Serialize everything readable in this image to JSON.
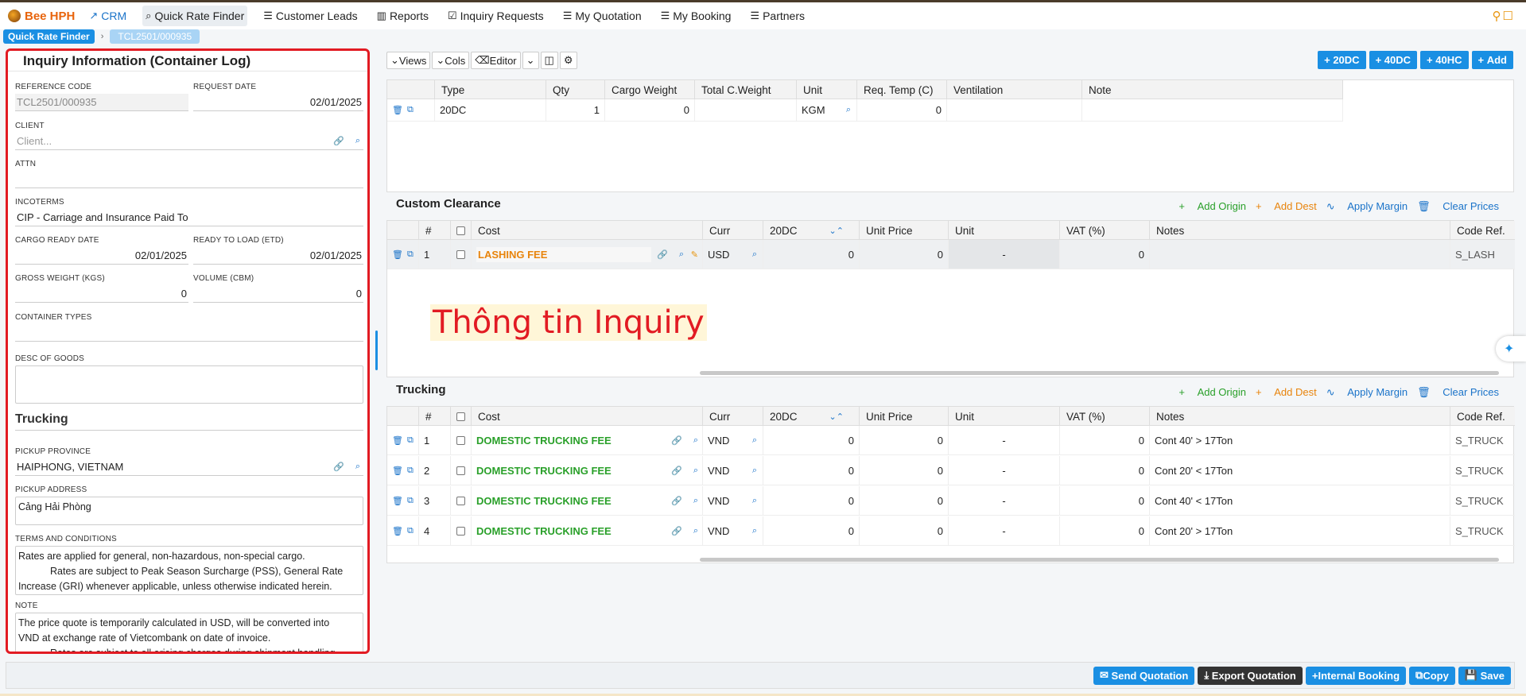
{
  "nav": {
    "brand": "Bee HPH",
    "items": [
      "CRM",
      "Quick Rate Finder",
      "Customer Leads",
      "Reports",
      "Inquiry Requests",
      "My Quotation",
      "My Booking",
      "Partners"
    ]
  },
  "breadcrumb": {
    "root": "Quick Rate Finder",
    "current": "TCL2501/000935"
  },
  "inquiry": {
    "title": "Inquiry Information (Container Log)",
    "reference_code_label": "REFERENCE CODE",
    "reference_code": "TCL2501/000935",
    "request_date_label": "REQUEST DATE",
    "request_date": "02/01/2025",
    "client_label": "CLIENT",
    "client_placeholder": "Client...",
    "attn_label": "ATTN",
    "incoterms_label": "INCOTERMS",
    "incoterms": "CIP - Carriage and Insurance Paid To",
    "cargo_ready_label": "CARGO READY DATE",
    "cargo_ready": "02/01/2025",
    "ready_load_label": "READY TO LOAD (ETD)",
    "ready_load": "02/01/2025",
    "gross_weight_label": "GROSS WEIGHT (KGS)",
    "gross_weight": "0",
    "volume_label": "VOLUME (CBM)",
    "volume": "0",
    "container_types_label": "CONTAINER TYPES",
    "desc_goods_label": "DESC OF GOODS",
    "trucking_section": "Trucking",
    "pickup_province_label": "PICKUP PROVINCE",
    "pickup_province": "HAIPHONG, VIETNAM",
    "pickup_address_label": "PICKUP ADDRESS",
    "pickup_address": "Cảng Hải Phòng",
    "terms_label": "TERMS AND CONDITIONS",
    "terms_line1": "Rates are applied for general, non-hazardous, non-special cargo.",
    "terms_line2": "Rates are subject to Peak Season Surcharge (PSS), General Rate",
    "terms_line3": "Increase (GRI) whenever applicable, unless otherwise indicated herein.",
    "note_label": "NOTE",
    "note_line1": "The price quote is temporarily calculated in USD, will be converted into",
    "note_line2": "VND at exchange rate of Vietcombank on date of invoice.",
    "note_line3": "Rates are subject to all arising charges during shipment handling"
  },
  "toolbar": {
    "views": "Views",
    "cols": "Cols",
    "editor": "Editor"
  },
  "add_buttons": [
    "20DC",
    "40DC",
    "40HC",
    "Add"
  ],
  "containers": {
    "headers": [
      "Type",
      "Qty",
      "Cargo Weight",
      "Total C.Weight",
      "Unit",
      "Req. Temp (C)",
      "Ventilation",
      "Note"
    ],
    "row": {
      "type": "20DC",
      "qty": "1",
      "cargo_weight": "0",
      "total": "",
      "unit": "KGM",
      "temp": "0"
    }
  },
  "actions": {
    "add_origin": "Add Origin",
    "add_dest": "Add Dest",
    "apply_margin": "Apply Margin",
    "clear_prices": "Clear Prices"
  },
  "cost_headers": [
    "#",
    "Cost",
    "Curr",
    "20DC",
    "Unit Price",
    "Unit",
    "VAT (%)",
    "Notes",
    "Code Ref."
  ],
  "custom": {
    "title": "Custom Clearance",
    "rows": [
      {
        "no": "1",
        "cost": "LASHING FEE",
        "curr": "USD",
        "dc20": "0",
        "unit_price": "0",
        "unit": "-",
        "vat": "0",
        "notes": "",
        "code": "S_LASH"
      }
    ]
  },
  "overlay_text": "Thông tin Inquiry",
  "trucking": {
    "title": "Trucking",
    "rows": [
      {
        "no": "1",
        "cost": "DOMESTIC TRUCKING FEE",
        "curr": "VND",
        "dc20": "0",
        "unit_price": "0",
        "unit": "-",
        "vat": "0",
        "notes": "Cont 40' > 17Ton",
        "code": "S_TRUCK"
      },
      {
        "no": "2",
        "cost": "DOMESTIC TRUCKING FEE",
        "curr": "VND",
        "dc20": "0",
        "unit_price": "0",
        "unit": "-",
        "vat": "0",
        "notes": "Cont 20' < 17Ton",
        "code": "S_TRUCK"
      },
      {
        "no": "3",
        "cost": "DOMESTIC TRUCKING FEE",
        "curr": "VND",
        "dc20": "0",
        "unit_price": "0",
        "unit": "-",
        "vat": "0",
        "notes": "Cont 40' < 17Ton",
        "code": "S_TRUCK"
      },
      {
        "no": "4",
        "cost": "DOMESTIC TRUCKING FEE",
        "curr": "VND",
        "dc20": "0",
        "unit_price": "0",
        "unit": "-",
        "vat": "0",
        "notes": "Cont 20' > 17Ton",
        "code": "S_TRUCK"
      }
    ]
  },
  "bottom": {
    "send": "Send Quotation",
    "export": "Export Quotation",
    "booking": "Internal Booking",
    "copy": "Copy",
    "save": "Save"
  }
}
